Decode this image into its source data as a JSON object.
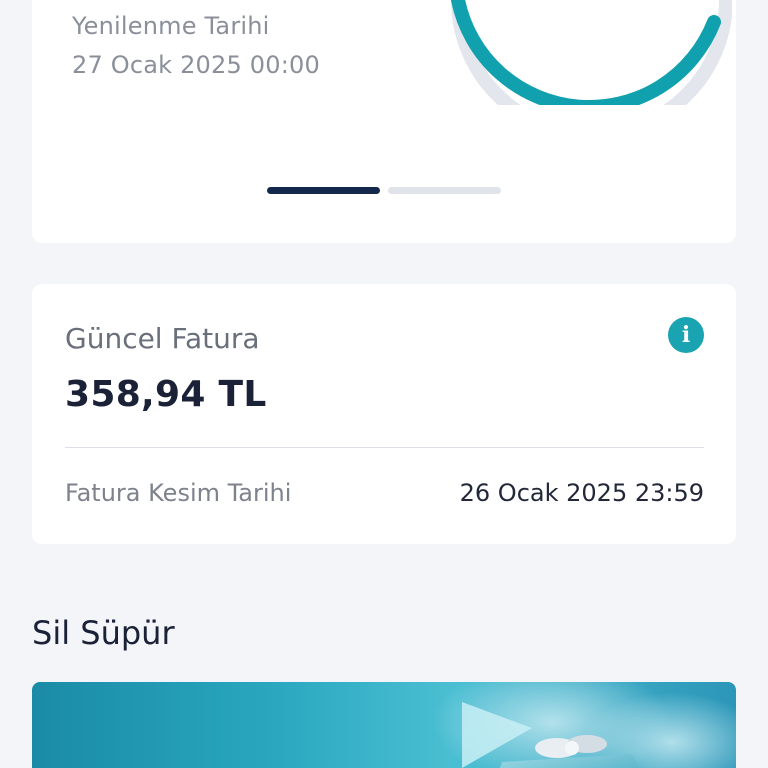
{
  "usage": {
    "renew_label": "Yenilenme Tarihi",
    "renew_date": "27 Ocak 2025 00:00",
    "gauge_fill_fraction": 0.95,
    "gauge_color": "#11a0ad",
    "gauge_track_color": "#e3e6ec",
    "pager": {
      "pages": 2,
      "active_index": 0
    }
  },
  "bill": {
    "title": "Güncel Fatura",
    "amount": "358,94 TL",
    "cut_label": "Fatura Kesim Tarihi",
    "cut_date": "26 Ocak 2025 23:59",
    "info_icon": "info-icon",
    "info_glyph": "i",
    "accent": "#1aa3b0"
  },
  "section": {
    "title": "Sil Süpür"
  },
  "banner": {
    "image": "gift-box-promo-image"
  }
}
